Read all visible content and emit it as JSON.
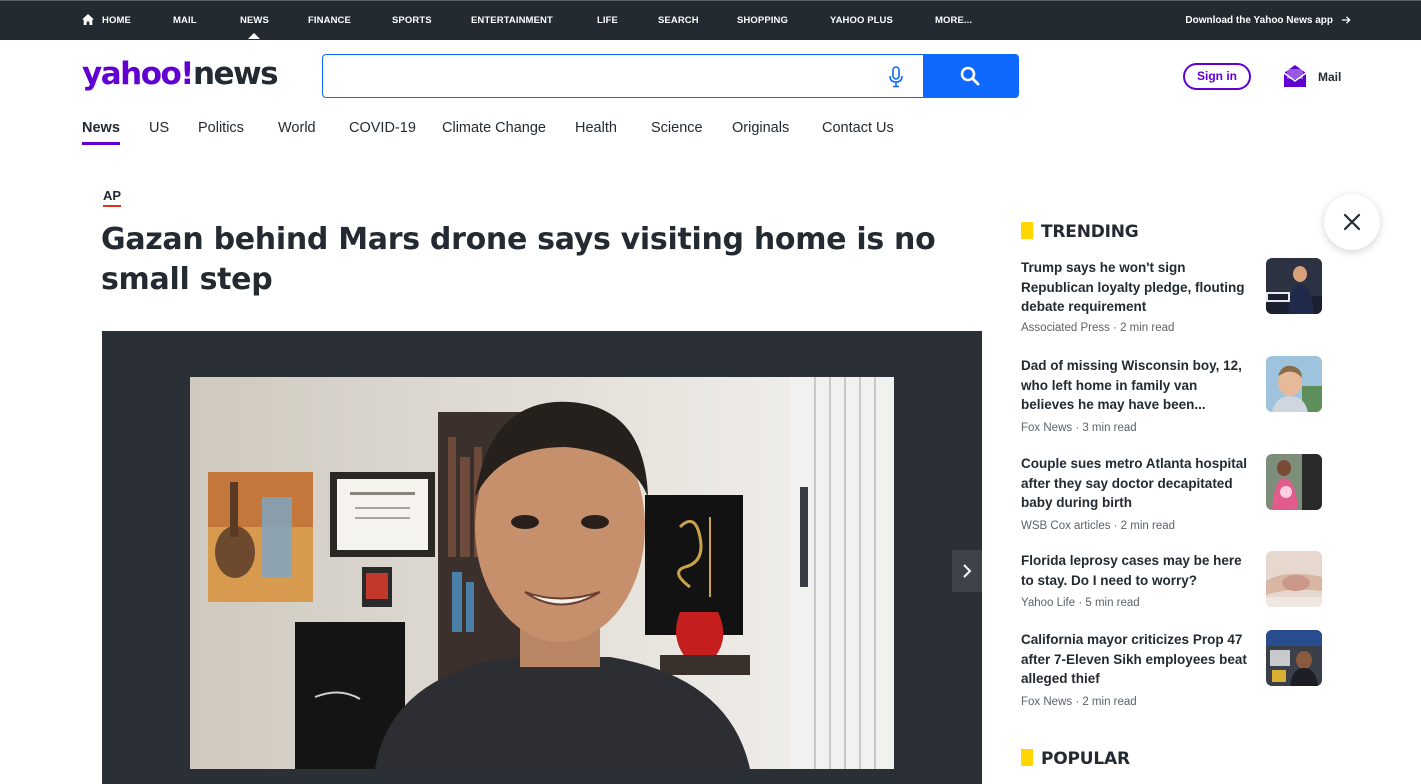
{
  "topnav": {
    "items": [
      "HOME",
      "MAIL",
      "NEWS",
      "FINANCE",
      "SPORTS",
      "ENTERTAINMENT",
      "LIFE",
      "SEARCH",
      "SHOPPING",
      "YAHOO PLUS",
      "MORE..."
    ],
    "active": "NEWS",
    "download": "Download the Yahoo News app"
  },
  "header": {
    "logo_brand": "yahoo!",
    "logo_section": "news",
    "search_placeholder": "",
    "signin": "Sign in",
    "mail": "Mail"
  },
  "subnav": {
    "items": [
      "News",
      "US",
      "Politics",
      "World",
      "COVID-19",
      "Climate Change",
      "Health",
      "Science",
      "Originals",
      "Contact Us"
    ],
    "active": "News"
  },
  "article": {
    "provider": "AP",
    "headline": "Gazan behind Mars drone says visiting home is no small step"
  },
  "trending": {
    "heading": "TRENDING",
    "items": [
      {
        "title": "Trump says he won't sign Republican loyalty pledge, flouting debate requirement",
        "meta": "Associated Press · 2 min read"
      },
      {
        "title": "Dad of missing Wisconsin boy, 12, who left home in family van believes he may have been...",
        "meta": "Fox News · 3 min read"
      },
      {
        "title": "Couple sues metro Atlanta hospital after they say doctor decapitated baby during birth",
        "meta": "WSB Cox articles · 2 min read"
      },
      {
        "title": "Florida leprosy cases may be here to stay. Do I need to worry?",
        "meta": "Yahoo Life · 5 min read"
      },
      {
        "title": "California mayor criticizes Prop 47 after 7-Eleven Sikh employees beat alleged thief",
        "meta": "Fox News · 2 min read"
      }
    ]
  },
  "popular": {
    "heading": "POPULAR"
  },
  "colors": {
    "brand": "#6001d2",
    "topbar": "#232a31",
    "search_blue": "#0f69ff",
    "trend_bar": "#ffd600",
    "provider_underline": "#e0301e"
  }
}
